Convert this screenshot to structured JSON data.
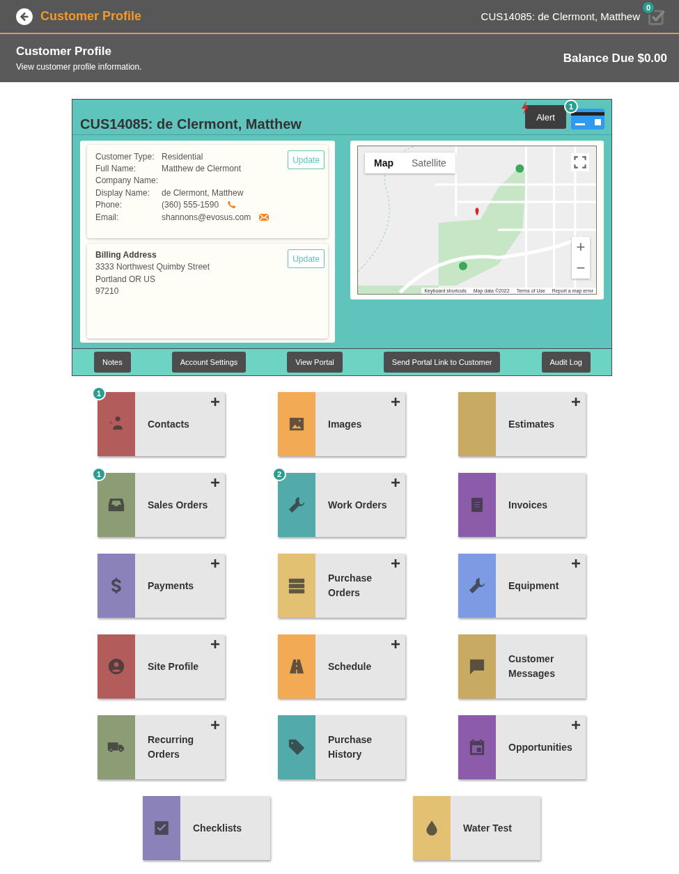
{
  "header": {
    "title": "Customer Profile",
    "customer": "CUS14085: de Clermont, Matthew",
    "task_count": "0"
  },
  "subheader": {
    "title": "Customer Profile",
    "subtitle": "View customer profile information.",
    "balance": "Balance Due $0.00"
  },
  "panel": {
    "title": "CUS14085: de Clermont, Matthew",
    "alert": "Alert",
    "card_badge": "1",
    "info": {
      "fields": [
        {
          "label": "Customer Type:",
          "value": "Residential"
        },
        {
          "label": "Full Name:",
          "value": "Matthew de Clermont"
        },
        {
          "label": "Company Name:"
        },
        {
          "label": "Display Name:",
          "value": "de Clermont, Matthew"
        },
        {
          "label": "Phone:",
          "value": "(360) 555-1590",
          "kind": "phone"
        },
        {
          "label": "Email:",
          "value": "shannons@evosus.com",
          "kind": "email"
        }
      ],
      "button": "Update"
    },
    "billing": {
      "title": "Billing Address",
      "lines": [
        "3333 Northwest Quimby Street",
        "Portland OR US",
        "97210"
      ],
      "button": "Update"
    },
    "map": {
      "tabs": [
        {
          "label": "Map",
          "selected": true
        },
        {
          "label": "Satellite",
          "selected": false
        }
      ],
      "zoom_in": "+",
      "zoom_out": "−",
      "footer": [
        "Keyboard shortcuts",
        "Map data ©2022",
        "Terms of Use",
        "Report a map error"
      ]
    },
    "actions": [
      "Notes",
      "Account Settings",
      "View Portal",
      "Send Portal Link to Customer",
      "Audit Log"
    ]
  },
  "tiles": [
    {
      "label": "Contacts",
      "color": "#b35c5c",
      "add": true,
      "badge": "1"
    },
    {
      "label": "Images",
      "color": "#f2aa55",
      "add": true
    },
    {
      "label": "Estimates",
      "color": "#c9aa62",
      "add": true
    },
    {
      "label": "Sales Orders",
      "color": "#8c9c74",
      "add": true,
      "badge": "1"
    },
    {
      "label": "Work Orders",
      "color": "#52aaaa",
      "add": true,
      "badge": "2"
    },
    {
      "label": "Invoices",
      "color": "#8c5cab",
      "add": false
    },
    {
      "label": "Payments",
      "color": "#8b82ba",
      "add": true
    },
    {
      "label": "Purchase Orders",
      "color": "#e2c272",
      "add": true
    },
    {
      "label": "Equipment",
      "color": "#7c9be2",
      "add": true
    },
    {
      "label": "Site Profile",
      "color": "#b35c5c",
      "add": true
    },
    {
      "label": "Schedule",
      "color": "#f2aa55",
      "add": true
    },
    {
      "label": "Customer Messages",
      "color": "#c9aa62",
      "add": false
    },
    {
      "label": "Recurring Orders",
      "color": "#8c9c74",
      "add": true
    },
    {
      "label": "Purchase History",
      "color": "#52aaaa",
      "add": false
    },
    {
      "label": "Opportunities",
      "color": "#8c5cab",
      "add": true
    },
    {
      "label": "Checklists",
      "color": "#8b82ba",
      "add": false
    },
    {
      "label": "Water Test",
      "color": "#e2c272",
      "add": false
    }
  ]
}
